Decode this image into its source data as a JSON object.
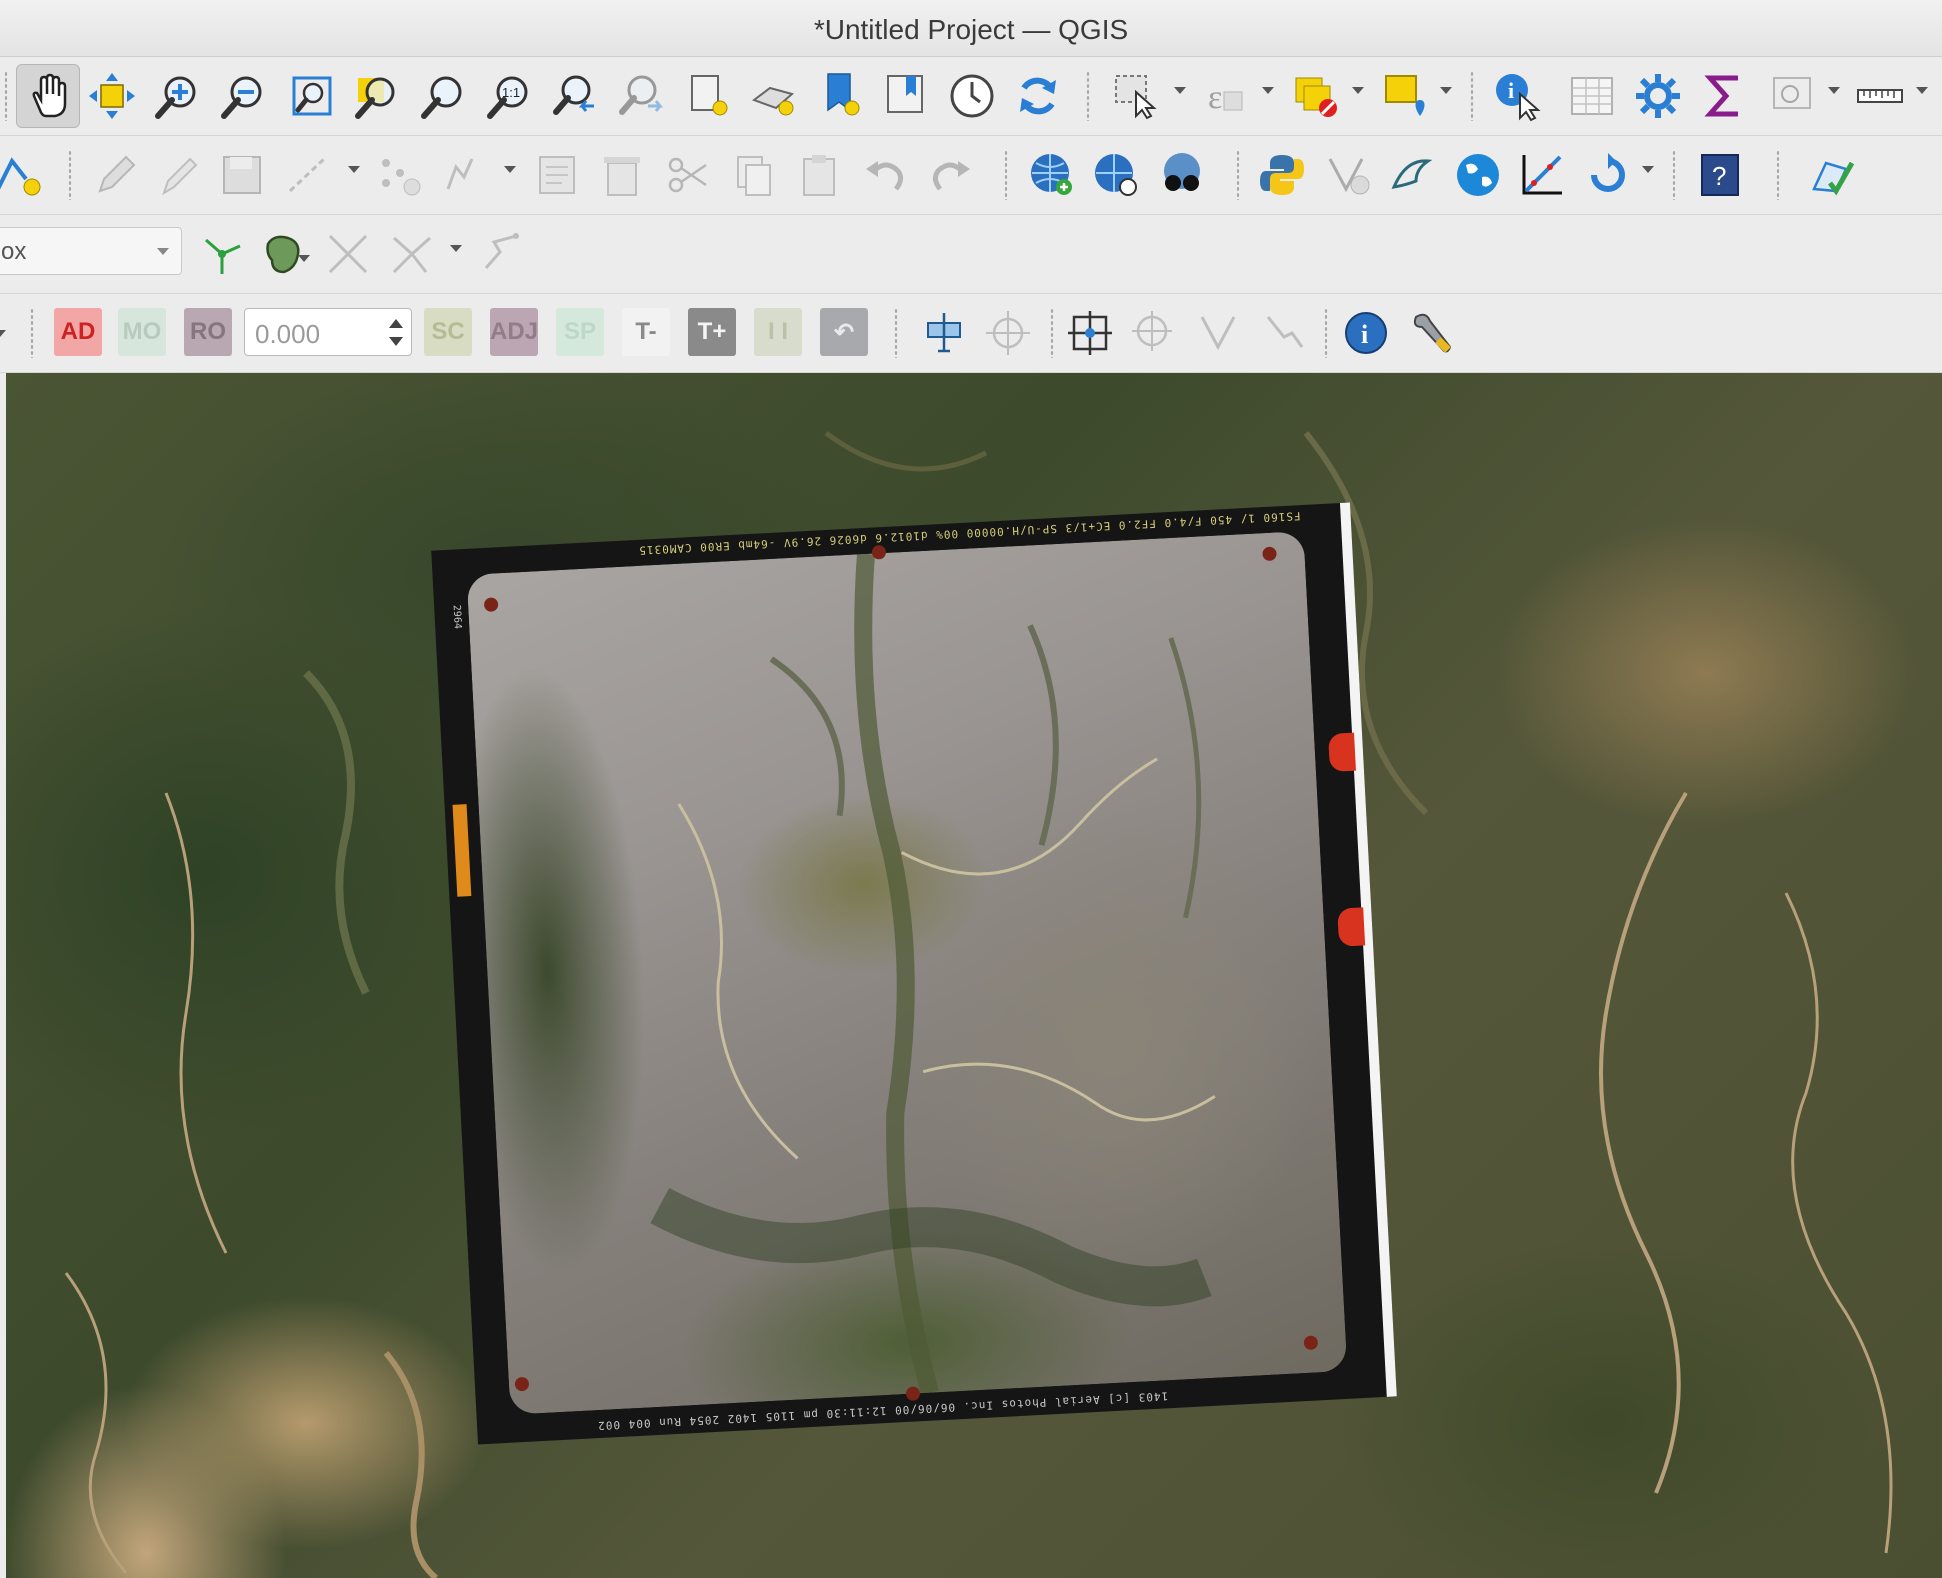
{
  "window": {
    "title": "*Untitled Project — QGIS"
  },
  "toolbar_row1": {
    "icons": [
      "pan-map-icon",
      "pan-to-selection-icon",
      "zoom-in-icon",
      "zoom-out-icon",
      "zoom-full-icon",
      "zoom-to-selection-icon",
      "zoom-to-layer-icon",
      "zoom-native-resolution-icon",
      "zoom-last-icon",
      "zoom-next-icon",
      "new-map-view-icon",
      "new-3d-map-view-icon",
      "new-spatial-bookmark-icon",
      "show-spatial-bookmarks-icon",
      "temporal-controller-icon",
      "refresh-icon",
      "select-features-icon",
      "select-by-value-icon",
      "deselect-features-icon",
      "add-annotation-icon",
      "identify-features-icon",
      "open-attribute-table-icon",
      "toolbox-icon",
      "statistical-summary-icon",
      "show-map-tips-icon",
      "measure-line-icon"
    ]
  },
  "toolbar_row2": {
    "icons": [
      "digitizing-current-layer-icon",
      "toggle-editing-icon",
      "save-layer-edits-icon",
      "add-line-feature-icon",
      "vertex-tool-icon",
      "modify-attributes-icon",
      "delete-selected-icon",
      "cut-features-icon",
      "copy-features-icon",
      "paste-features-icon",
      "undo-icon",
      "redo-icon",
      "add-wms-layer-icon",
      "metasearch-icon",
      "quickmapservices-icon",
      "python-console-icon",
      "processing-tool-icon",
      "plugin-bird-icon",
      "globe-icon",
      "georeferencer-icon",
      "reload-icon",
      "help-icon",
      "topology-checker-icon"
    ]
  },
  "toolbar_row3": {
    "combo_text": "ox",
    "icons": [
      "snapping-vertex-icon",
      "snapping-area-icon",
      "snapping-intersection-icon",
      "snapping-self-icon",
      "tracing-icon"
    ]
  },
  "toolbar_row4": {
    "buttons": [
      {
        "label": "AD",
        "bg": "#f3a6a6",
        "fg": "#cc2222"
      },
      {
        "label": "MO",
        "bg": "#d7e6dc",
        "fg": "#b6cbbd"
      },
      {
        "label": "RO",
        "bg": "#b9a7b2",
        "fg": "#877480"
      },
      {
        "label": "SC",
        "bg": "#d8dcc2",
        "fg": "#b5bc95"
      },
      {
        "label": "ADJ",
        "bg": "#bca6b3",
        "fg": "#927c88"
      },
      {
        "label": "SP",
        "bg": "#d4e8dc",
        "fg": "#bcd8c6"
      },
      {
        "label": "T-",
        "bg": "#f2f2f2",
        "fg": "#8a8a8a"
      },
      {
        "label": "T+",
        "bg": "#8a8a8a",
        "fg": "#f4f4f4"
      },
      {
        "label": "I I",
        "bg": "#d7dccc",
        "fg": "#b9c1a7"
      },
      {
        "label": "↶",
        "bg": "#a8a9ad",
        "fg": "#e9e9ea"
      }
    ],
    "spin_value": "0.000",
    "icons": [
      "rotate-label-icon",
      "move-point-icon",
      "add-point-icon",
      "add-vertex-icon",
      "move-vertex-icon",
      "info-icon",
      "settings-wrench-icon"
    ]
  },
  "map": {
    "photo_header": "FS160 1/ 450 F/4.0 FF2.0 EC+1/3 SP-U/H.00000 00% d1012.6 d6026 26.9V -64mb ER00 CAM0315",
    "photo_footer": "1403 [c] Aerial Photos Inc. 06/06/00 12:11:30 pm 1105 1402 2054 Run 004 002",
    "frame_number": "2964"
  },
  "colors": {
    "accent_blue": "#2a7fd4",
    "selection_yellow": "#f5d10a"
  }
}
